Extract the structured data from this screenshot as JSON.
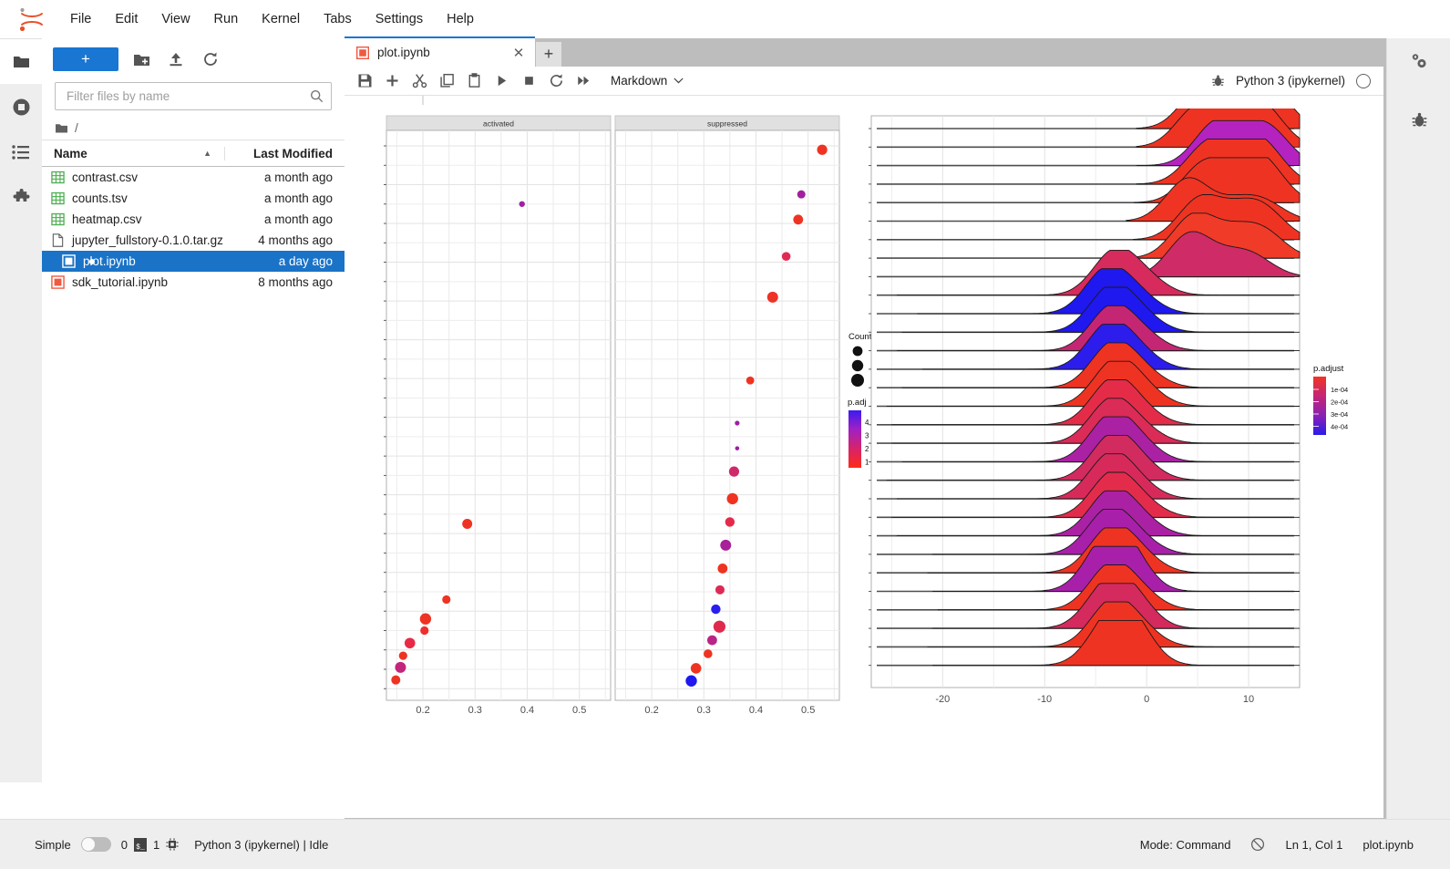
{
  "menubar": {
    "logo_icon": "jupyter-logo-icon",
    "items": [
      {
        "label": "File",
        "name": "menu-file"
      },
      {
        "label": "Edit",
        "name": "menu-edit"
      },
      {
        "label": "View",
        "name": "menu-view"
      },
      {
        "label": "Run",
        "name": "menu-run"
      },
      {
        "label": "Kernel",
        "name": "menu-kernel"
      },
      {
        "label": "Tabs",
        "name": "menu-tabs"
      },
      {
        "label": "Settings",
        "name": "menu-settings"
      },
      {
        "label": "Help",
        "name": "menu-help"
      }
    ]
  },
  "activitybar": {
    "items": [
      {
        "icon": "folder-icon",
        "name": "sidebar-item-file-browser",
        "selected": false
      },
      {
        "icon": "running-terminals-icon",
        "name": "sidebar-item-running",
        "selected": true
      },
      {
        "icon": "table-of-contents-icon",
        "name": "sidebar-item-toc",
        "selected": false
      },
      {
        "icon": "extension-puzzle-icon",
        "name": "sidebar-item-extensions",
        "selected": false
      }
    ]
  },
  "rightbar": {
    "items": [
      {
        "icon": "property-inspector-gear-icon",
        "name": "sidebar-item-property-inspector"
      },
      {
        "icon": "debugger-bug-icon",
        "name": "sidebar-item-debugger"
      }
    ]
  },
  "filebrowser": {
    "new_launcher_label": "+",
    "toolbar_icons": [
      {
        "icon": "new-folder-icon",
        "name": "new-folder-button"
      },
      {
        "icon": "upload-icon",
        "name": "upload-files-button"
      },
      {
        "icon": "refresh-icon",
        "name": "refresh-file-list-button"
      }
    ],
    "filter_placeholder": "Filter files by name",
    "filter_value": "",
    "search_icon": "search-icon",
    "breadcrumb": "/",
    "breadcrumb_icon": "folder-icon",
    "columns": {
      "name": "Name",
      "last_modified": "Last Modified"
    },
    "sort_caret": "▲",
    "files": [
      {
        "name": "contrast.csv",
        "modified": "a month ago",
        "icon": "spreadsheet-icon",
        "selected": false,
        "dirty": false
      },
      {
        "name": "counts.tsv",
        "modified": "a month ago",
        "icon": "spreadsheet-icon",
        "selected": false,
        "dirty": false
      },
      {
        "name": "heatmap.csv",
        "modified": "a month ago",
        "icon": "spreadsheet-icon",
        "selected": false,
        "dirty": false
      },
      {
        "name": "jupyter_fullstory-0.1.0.tar.gz",
        "modified": "4 months ago",
        "icon": "file-icon",
        "selected": false,
        "dirty": false
      },
      {
        "name": "plot.ipynb",
        "modified": "a day ago",
        "icon": "notebook-icon",
        "selected": true,
        "dirty": true
      },
      {
        "name": "sdk_tutorial.ipynb",
        "modified": "8 months ago",
        "icon": "notebook-icon",
        "selected": false,
        "dirty": false
      }
    ]
  },
  "dock": {
    "tab": {
      "title": "plot.ipynb",
      "icon": "notebook-icon",
      "close_icon": "close-icon"
    },
    "new_tab_label": "+"
  },
  "notebook_toolbar": {
    "icons": [
      {
        "icon": "save-icon",
        "name": "save-notebook-button"
      },
      {
        "icon": "add-cell-icon",
        "name": "insert-cell-button"
      },
      {
        "icon": "cut-scissors-icon",
        "name": "cut-cell-button"
      },
      {
        "icon": "copy-icon",
        "name": "copy-cell-button"
      },
      {
        "icon": "paste-icon",
        "name": "paste-cell-button"
      },
      {
        "icon": "run-play-icon",
        "name": "run-cell-button"
      },
      {
        "icon": "stop-square-icon",
        "name": "interrupt-kernel-button"
      },
      {
        "icon": "restart-refresh-icon",
        "name": "restart-kernel-button"
      },
      {
        "icon": "restart-run-all-icon",
        "name": "restart-run-all-button"
      }
    ],
    "cell_type": "Markdown",
    "cell_type_caret": "⌄",
    "kernel_bug_icon": "debugger-bug-icon",
    "kernel_name": "Python 3 (ipykernel)",
    "kernel_status_icon": "kernel-idle-circle-icon"
  },
  "statusbar": {
    "simple_label": "Simple",
    "simple_toggle_on": false,
    "kernel_count": "0",
    "terminal_icon": "terminal-icon",
    "kernel_sessions": "1",
    "cpu_icon": "kernel-chip-icon",
    "kernel_text": "Python 3 (ipykernel) | Idle",
    "mode": "Mode: Command",
    "no_connection_icon": "no-connection-icon",
    "cursor": "Ln 1, Col 1",
    "filename": "plot.ipynb"
  },
  "chart_data": [
    {
      "type": "scatter",
      "name": "gsea-dotplot",
      "title": "",
      "xlabel": "",
      "ylabel": "",
      "facets": [
        "activated",
        "suppressed"
      ],
      "xticks": [
        0.2,
        0.3,
        0.4,
        0.5
      ],
      "xlim": [
        0.13,
        0.56
      ],
      "grid": true,
      "legends": [
        {
          "title": "Count",
          "type": "size",
          "sizes": [
            1,
            2,
            3
          ]
        },
        {
          "title": "p.adj",
          "type": "colorbar",
          "ticks": [
            "1",
            "2",
            "3",
            "4"
          ],
          "colors": [
            "#ff2a16",
            "#d6236b",
            "#a020c4",
            "#3b1bf0"
          ]
        }
      ],
      "series": [
        {
          "name": "activated",
          "points": [
            {
              "x": 0.39,
              "y": 25,
              "size": 3.2,
              "color": "#a0209f"
            },
            {
              "x": 0.285,
              "y": 8.5,
              "size": 5.5,
              "color": "#ef3322"
            },
            {
              "x": 0.245,
              "y": 4.6,
              "size": 4.6,
              "color": "#ef3322"
            },
            {
              "x": 0.205,
              "y": 3.6,
              "size": 6.2,
              "color": "#ef3322"
            },
            {
              "x": 0.203,
              "y": 3.0,
              "size": 4.6,
              "color": "#ee2f2c"
            },
            {
              "x": 0.175,
              "y": 2.35,
              "size": 5.8,
              "color": "#e92a46"
            },
            {
              "x": 0.162,
              "y": 1.7,
              "size": 4.6,
              "color": "#ef3322"
            },
            {
              "x": 0.157,
              "y": 1.1,
              "size": 6.0,
              "color": "#c2257c"
            },
            {
              "x": 0.148,
              "y": 0.45,
              "size": 5.0,
              "color": "#ef3322"
            }
          ]
        },
        {
          "name": "suppressed",
          "points": [
            {
              "x": 0.527,
              "y": 27.8,
              "size": 5.6,
              "color": "#ef3322"
            },
            {
              "x": 0.487,
              "y": 25.5,
              "size": 4.5,
              "color": "#a0209f"
            },
            {
              "x": 0.481,
              "y": 24.2,
              "size": 5.4,
              "color": "#ef3322"
            },
            {
              "x": 0.458,
              "y": 22.3,
              "size": 4.8,
              "color": "#e12a52"
            },
            {
              "x": 0.432,
              "y": 20.2,
              "size": 6.0,
              "color": "#ee3227"
            },
            {
              "x": 0.389,
              "y": 15.9,
              "size": 4.4,
              "color": "#ef3322"
            },
            {
              "x": 0.364,
              "y": 13.7,
              "size": 2.6,
              "color": "#9f1fa5"
            },
            {
              "x": 0.364,
              "y": 12.4,
              "size": 2.3,
              "color": "#9f1fa5"
            },
            {
              "x": 0.358,
              "y": 11.2,
              "size": 5.6,
              "color": "#ce2a68"
            },
            {
              "x": 0.355,
              "y": 9.8,
              "size": 6.2,
              "color": "#ef3322"
            },
            {
              "x": 0.35,
              "y": 8.6,
              "size": 5.2,
              "color": "#e5294b"
            },
            {
              "x": 0.342,
              "y": 7.4,
              "size": 6.0,
              "color": "#a8209a"
            },
            {
              "x": 0.336,
              "y": 6.2,
              "size": 5.4,
              "color": "#ef3322"
            },
            {
              "x": 0.331,
              "y": 5.1,
              "size": 5.0,
              "color": "#dc2a55"
            },
            {
              "x": 0.323,
              "y": 4.1,
              "size": 5.2,
              "color": "#2a1ef0"
            },
            {
              "x": 0.33,
              "y": 3.2,
              "size": 6.6,
              "color": "#e02a4d"
            },
            {
              "x": 0.316,
              "y": 2.5,
              "size": 5.4,
              "color": "#b92585"
            },
            {
              "x": 0.308,
              "y": 1.8,
              "size": 4.8,
              "color": "#ef3322"
            },
            {
              "x": 0.285,
              "y": 1.05,
              "size": 5.8,
              "color": "#ef3322"
            },
            {
              "x": 0.276,
              "y": 0.4,
              "size": 6.2,
              "color": "#1f18ef"
            }
          ]
        }
      ]
    },
    {
      "type": "area",
      "name": "gsea-ridgeplot",
      "title": "",
      "xlabel": "",
      "ylabel": "",
      "xticks": [
        -20,
        -10,
        0,
        10
      ],
      "xlim": [
        -27,
        15
      ],
      "grid": true,
      "legend": {
        "title": "p.adjust",
        "ticks": [
          "1e-04",
          "2e-04",
          "3e-04",
          "4e-04"
        ],
        "colors": [
          "#f23424",
          "#c32577",
          "#8a21b5",
          "#2a1bec"
        ]
      },
      "rows": [
        {
          "index": 1,
          "color": "#ef3322",
          "peaks": [
            [
              5.5,
              1.0
            ],
            [
              9.5,
              0.62
            ],
            [
              12.0,
              0.88
            ]
          ],
          "left": -1.0
        },
        {
          "index": 2,
          "color": "#ef3322",
          "peaks": [
            [
              5.0,
              0.95
            ],
            [
              9.0,
              0.58
            ],
            [
              11.5,
              0.82
            ]
          ],
          "left": -1.0
        },
        {
          "index": 3,
          "color": "#b423c0",
          "peaks": [
            [
              6.8,
              1.0
            ],
            [
              10.5,
              0.45
            ],
            [
              12.2,
              0.62
            ]
          ],
          "left": -1.0
        },
        {
          "index": 4,
          "color": "#ef3322",
          "peaks": [
            [
              5.8,
              0.85
            ],
            [
              9.0,
              0.6
            ],
            [
              11.5,
              0.8
            ]
          ],
          "left": -1.0
        },
        {
          "index": 5,
          "color": "#ef3322",
          "peaks": [
            [
              5.6,
              0.9
            ],
            [
              9.4,
              0.6
            ],
            [
              11.6,
              0.78
            ]
          ],
          "left": -1.2
        },
        {
          "index": 6,
          "color": "#f03423",
          "peaks": [
            [
              4.0,
              1.0
            ],
            [
              8.5,
              0.38
            ],
            [
              11.5,
              0.42
            ]
          ],
          "left": -2.0
        },
        {
          "index": 7,
          "color": "#ef3322",
          "peaks": [
            [
              5.2,
              0.95
            ],
            [
              9.0,
              0.52
            ],
            [
              11.6,
              0.62
            ]
          ],
          "left": -1.3
        },
        {
          "index": 8,
          "color": "#f03b28",
          "peaks": [
            [
              4.6,
              1.0
            ],
            [
              8.5,
              0.5
            ],
            [
              11.5,
              0.58
            ]
          ],
          "left": -2.0
        },
        {
          "index": 9,
          "color": "#cf2b66",
          "peaks": [
            [
              4.2,
              1.0
            ],
            [
              8.0,
              0.35
            ],
            [
              10.5,
              0.4
            ]
          ],
          "left": -2.5
        },
        {
          "index": 10,
          "color": "#d62b5c",
          "peaks": [
            [
              -3.2,
              1.0
            ],
            [
              -0.2,
              0.38
            ]
          ],
          "left": -24.5
        },
        {
          "index": 11,
          "color": "#1f18ef",
          "peaks": [
            [
              -4.0,
              1.0
            ],
            [
              -1.0,
              0.42
            ]
          ],
          "left": -22.5
        },
        {
          "index": 12,
          "color": "#1f18ef",
          "peaks": [
            [
              -3.6,
              1.0
            ],
            [
              -0.8,
              0.4
            ]
          ],
          "left": -24.0
        },
        {
          "index": 13,
          "color": "#c52673",
          "peaks": [
            [
              -3.5,
              1.0
            ],
            [
              -0.5,
              0.35
            ]
          ],
          "left": -24.5
        },
        {
          "index": 14,
          "color": "#2c1ded",
          "peaks": [
            [
              -3.8,
              1.0
            ],
            [
              -1.0,
              0.4
            ]
          ],
          "left": -22.0
        },
        {
          "index": 15,
          "color": "#ef3322",
          "peaks": [
            [
              -3.4,
              1.0
            ],
            [
              -0.5,
              0.35
            ]
          ],
          "left": -24.0
        },
        {
          "index": 16,
          "color": "#ef3322",
          "peaks": [
            [
              -3.2,
              1.0
            ],
            [
              -0.5,
              0.38
            ]
          ],
          "left": -25.5
        },
        {
          "index": 17,
          "color": "#e42c49",
          "peaks": [
            [
              -3.4,
              1.0
            ],
            [
              -0.8,
              0.33
            ]
          ],
          "left": -25.0
        },
        {
          "index": 18,
          "color": "#db2b57",
          "peaks": [
            [
              -3.5,
              1.0
            ],
            [
              -0.6,
              0.3
            ]
          ],
          "left": -25.0
        },
        {
          "index": 19,
          "color": "#ab21a4",
          "peaks": [
            [
              -3.6,
              1.0
            ],
            [
              -0.9,
              0.42
            ]
          ],
          "left": -24.0
        },
        {
          "index": 20,
          "color": "#d22b60",
          "peaks": [
            [
              -3.4,
              1.0
            ],
            [
              -0.8,
              0.35
            ]
          ],
          "left": -25.5
        },
        {
          "index": 21,
          "color": "#d82a5a",
          "peaks": [
            [
              -3.6,
              1.0
            ],
            [
              -1.0,
              0.3
            ]
          ],
          "left": -24.5
        },
        {
          "index": 22,
          "color": "#e32c4b",
          "peaks": [
            [
              -3.4,
              1.0
            ],
            [
              -0.6,
              0.32
            ]
          ],
          "left": -25.0
        },
        {
          "index": 23,
          "color": "#ab21a4",
          "peaks": [
            [
              -3.6,
              1.0
            ],
            [
              -0.8,
              0.38
            ]
          ],
          "left": -24.5
        },
        {
          "index": 24,
          "color": "#a820aa",
          "peaks": [
            [
              -3.8,
              1.0
            ],
            [
              -1.0,
              0.35
            ]
          ],
          "left": -21.0
        },
        {
          "index": 25,
          "color": "#ef3322",
          "peaks": [
            [
              -3.6,
              1.0
            ],
            [
              -0.8,
              0.4
            ]
          ],
          "left": -21.5
        },
        {
          "index": 26,
          "color": "#a820aa",
          "peaks": [
            [
              -4.2,
              0.9
            ],
            [
              -2.0,
              0.92
            ]
          ],
          "left": -21.0
        },
        {
          "index": 27,
          "color": "#ef3322",
          "peaks": [
            [
              -3.6,
              1.0
            ],
            [
              -0.8,
              0.38
            ]
          ],
          "left": -20.5
        },
        {
          "index": 28,
          "color": "#d42a5e",
          "peaks": [
            [
              -4.0,
              0.88
            ],
            [
              -1.5,
              0.72
            ]
          ],
          "left": -21.0
        },
        {
          "index": 29,
          "color": "#ef3322",
          "peaks": [
            [
              -3.5,
              1.0
            ],
            [
              -0.8,
              0.4
            ]
          ],
          "left": -21.5
        },
        {
          "index": 30,
          "color": "#ef3322",
          "peaks": [
            [
              -3.8,
              0.85
            ],
            [
              -1.5,
              0.95
            ]
          ],
          "left": -21.0
        }
      ]
    }
  ]
}
